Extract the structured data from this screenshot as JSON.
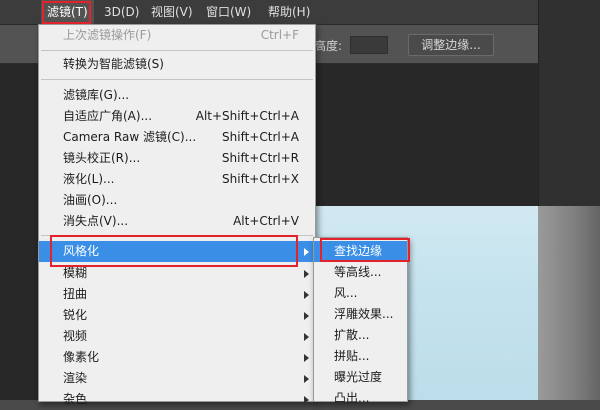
{
  "menubar": {
    "filter": "滤镜(T)",
    "threed": "3D(D)",
    "view": "视图(V)",
    "window": "窗口(W)",
    "help": "帮助(H)"
  },
  "options_bar": {
    "height_label": "高度:",
    "refine_edge": "调整边缘..."
  },
  "filter_menu": {
    "last_filter": {
      "label": "上次滤镜操作(F)",
      "shortcut": "Ctrl+F"
    },
    "smart_filters": {
      "label": "转换为智能滤镜(S)"
    },
    "gallery": {
      "label": "滤镜库(G)..."
    },
    "adaptive_wide": {
      "label": "自适应广角(A)...",
      "shortcut": "Alt+Shift+Ctrl+A"
    },
    "camera_raw": {
      "label": "Camera Raw 滤镜(C)...",
      "shortcut": "Shift+Ctrl+A"
    },
    "lens_correction": {
      "label": "镜头校正(R)...",
      "shortcut": "Shift+Ctrl+R"
    },
    "liquify": {
      "label": "液化(L)...",
      "shortcut": "Shift+Ctrl+X"
    },
    "oil_paint": {
      "label": "油画(O)..."
    },
    "vanishing_point": {
      "label": "消失点(V)...",
      "shortcut": "Alt+Ctrl+V"
    },
    "stylize": {
      "label": "风格化"
    },
    "blur": {
      "label": "模糊"
    },
    "distort": {
      "label": "扭曲"
    },
    "sharpen": {
      "label": "锐化"
    },
    "video": {
      "label": "视频"
    },
    "pixelate": {
      "label": "像素化"
    },
    "render": {
      "label": "渲染"
    },
    "noise": {
      "label": "杂色"
    }
  },
  "stylize_submenu": {
    "items": [
      "查找边缘",
      "等高线...",
      "风...",
      "浮雕效果...",
      "扩散...",
      "拼贴...",
      "曝光过度",
      "凸出..."
    ]
  },
  "colors": {
    "highlight": "#3a8ee6",
    "annotation": "#e3232b"
  }
}
